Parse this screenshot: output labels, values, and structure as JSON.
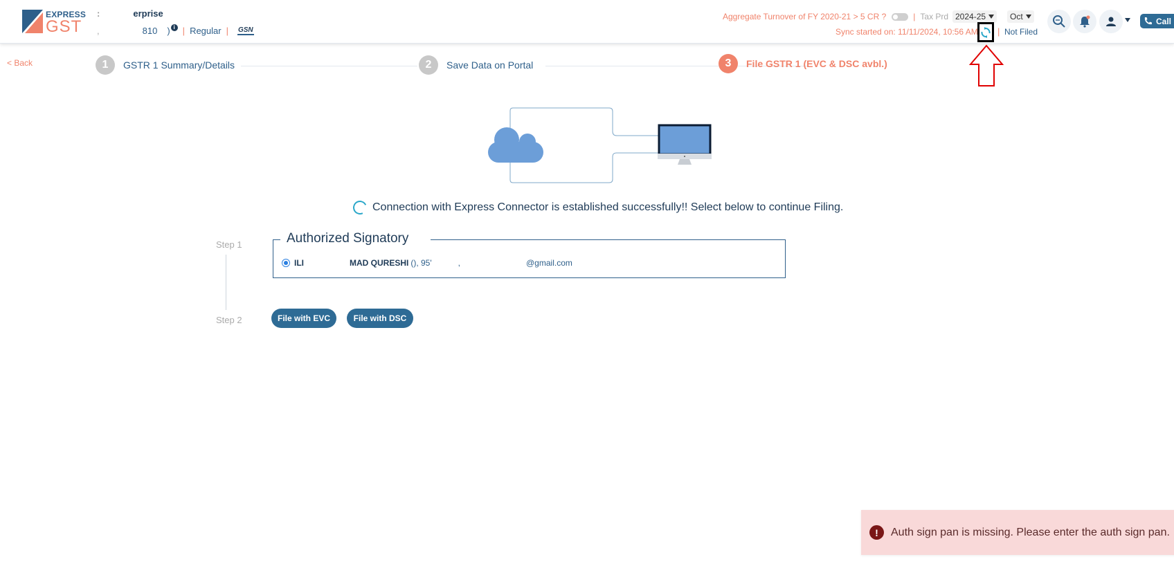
{
  "header": {
    "logo": {
      "top": "EXPRESS",
      "main": "GST"
    },
    "company": {
      "lead": ":",
      "name": "erprise"
    },
    "gstin_row": {
      "muted": ",",
      "number": "810",
      "tail": ")",
      "info": "i",
      "type": "Regular",
      "portal": "GSN"
    },
    "turnover_text": "Aggregate Turnover of FY 2020-21 > 5 CR ?",
    "tax_period_label": "Tax Prd",
    "year_select": "2024-25",
    "month_select": "Oct",
    "sync_text": "Sync started on: 11/11/2024, 10:56 AM",
    "filing_status": "Not Filed",
    "call_label": "Call"
  },
  "nav": {
    "back": "< Back",
    "steps": [
      {
        "num": "1",
        "label": "GSTR 1 Summary/Details"
      },
      {
        "num": "2",
        "label": "Save Data on Portal"
      },
      {
        "num": "3",
        "label": "File GSTR 1 (EVC & DSC avbl.)"
      }
    ]
  },
  "main": {
    "connection_message": "Connection with Express Connector is established successfully!! Select below to continue Filing.",
    "step1_label": "Step 1",
    "step2_label": "Step 2",
    "auth_title": "Authorized Signatory",
    "signatory": {
      "name_part1": "ILI",
      "name_part2": "MAD QURESHI",
      "extra": "(), 95'",
      "extra2": ",",
      "email": "@gmail.com"
    },
    "file_evc": "File with EVC",
    "file_dsc": "File with DSC"
  },
  "toast": {
    "icon": "!",
    "message": "Auth sign pan is missing. Please enter the auth sign pan."
  },
  "colors": {
    "accent_orange": "#f0836b",
    "primary_blue": "#2e6b95",
    "text_navy": "#1f3b57",
    "error_bg": "#f9d9d9"
  }
}
